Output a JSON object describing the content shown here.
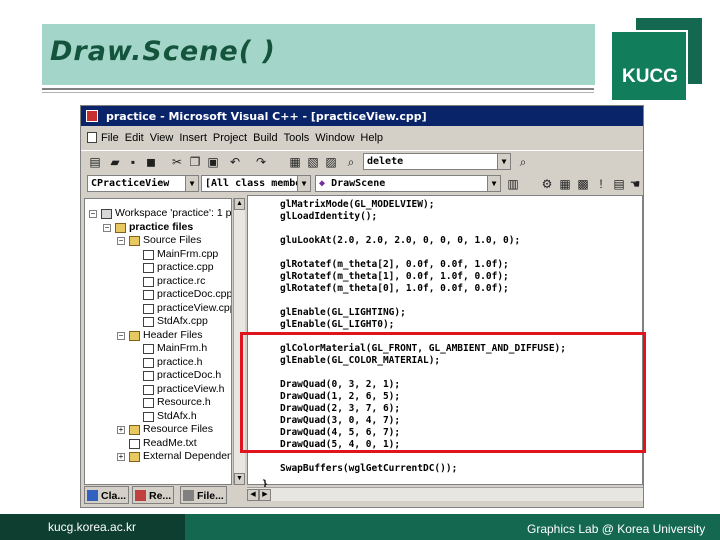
{
  "slide": {
    "title": "Draw.Scene( )",
    "logo": "KUCG",
    "footer_url": "kucg.korea.ac.kr",
    "footer_lab": "Graphics Lab @ Korea University"
  },
  "window": {
    "title": "practice - Microsoft Visual C++ - [practiceView.cpp]",
    "menus": [
      "File",
      "Edit",
      "View",
      "Insert",
      "Project",
      "Build",
      "Tools",
      "Window",
      "Help"
    ],
    "find_combo": "delete",
    "class_combo": "CPracticeView",
    "filter_combo": "[All class members]",
    "member_combo": "DrawScene"
  },
  "workspace": {
    "tree": [
      {
        "label": "Workspace 'practice': 1 p",
        "level": 0,
        "icon": "workspace",
        "expander": "minus"
      },
      {
        "label": "practice files",
        "level": 1,
        "icon": "project",
        "expander": "minus",
        "bold": true
      },
      {
        "label": "Source Files",
        "level": 2,
        "icon": "folder",
        "expander": "minus"
      },
      {
        "label": "MainFrm.cpp",
        "level": 3,
        "icon": "file"
      },
      {
        "label": "practice.cpp",
        "level": 3,
        "icon": "file"
      },
      {
        "label": "practice.rc",
        "level": 3,
        "icon": "file"
      },
      {
        "label": "practiceDoc.cpp",
        "level": 3,
        "icon": "file"
      },
      {
        "label": "practiceView.cpp",
        "level": 3,
        "icon": "file"
      },
      {
        "label": "StdAfx.cpp",
        "level": 3,
        "icon": "file"
      },
      {
        "label": "Header Files",
        "level": 2,
        "icon": "folder",
        "expander": "minus"
      },
      {
        "label": "MainFrm.h",
        "level": 3,
        "icon": "file"
      },
      {
        "label": "practice.h",
        "level": 3,
        "icon": "file"
      },
      {
        "label": "practiceDoc.h",
        "level": 3,
        "icon": "file"
      },
      {
        "label": "practiceView.h",
        "level": 3,
        "icon": "file"
      },
      {
        "label": "Resource.h",
        "level": 3,
        "icon": "file"
      },
      {
        "label": "StdAfx.h",
        "level": 3,
        "icon": "file"
      },
      {
        "label": "Resource Files",
        "level": 2,
        "icon": "folder",
        "expander": "plus"
      },
      {
        "label": "ReadMe.txt",
        "level": 2,
        "icon": "file"
      },
      {
        "label": "External Dependen",
        "level": 2,
        "icon": "folder",
        "expander": "plus"
      }
    ],
    "tabs": [
      "Cla...",
      "Re...",
      "File..."
    ]
  },
  "code": {
    "lines": [
      "glMatrixMode(GL_MODELVIEW);",
      "glLoadIdentity();",
      "",
      "gluLookAt(2.0, 2.0, 2.0, 0, 0, 0, 1.0, 0);",
      "",
      "glRotatef(m_theta[2], 0.0f, 0.0f, 1.0f);",
      "glRotatef(m_theta[1], 0.0f, 1.0f, 0.0f);",
      "glRotatef(m_theta[0], 1.0f, 0.0f, 0.0f);",
      "",
      "glEnable(GL_LIGHTING);",
      "glEnable(GL_LIGHT0);",
      "",
      "glColorMaterial(GL_FRONT, GL_AMBIENT_AND_DIFFUSE);",
      "glEnable(GL_COLOR_MATERIAL);",
      "",
      "DrawQuad(0, 3, 2, 1);",
      "DrawQuad(1, 2, 6, 5);",
      "DrawQuad(2, 3, 7, 6);",
      "DrawQuad(3, 0, 4, 7);",
      "DrawQuad(4, 5, 6, 7);",
      "DrawQuad(5, 4, 0, 1);",
      "",
      "SwapBuffers(wglGetCurrentDC());"
    ],
    "closing_brace": "}"
  },
  "colors": {
    "highlight": "#e0141c",
    "title_band": "#a3d6c9",
    "brand_green": "#14684f",
    "window_title": "#0a246a"
  }
}
